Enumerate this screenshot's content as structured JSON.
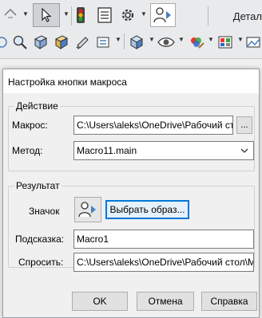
{
  "toolbar": {
    "document_title": "Детал",
    "icons_row1": [
      "dropdown-arrow-icon",
      "select-arrow-icon",
      "traffic-light-icon",
      "properties-icon",
      "gear-icon",
      "macro-user-icon"
    ],
    "icons_row2": [
      "zoom-to-fit-icon",
      "zoom-area-icon",
      "previous-view-icon",
      "section-view-icon",
      "view-orientation-icon",
      "display-style-icon",
      "hide-show-icon",
      "edit-appearance-icon",
      "scenes-icon",
      "view-settings-icon"
    ]
  },
  "dialog": {
    "title": "Настройка кнопки макроса",
    "action_group": {
      "legend": "Действие",
      "macro_label": "Макрос:",
      "macro_value": "C:\\Users\\aleks\\OneDrive\\Рабочий ст",
      "browse_label": "...",
      "method_label": "Метод:",
      "method_value": "Macro11.main"
    },
    "result_group": {
      "legend": "Результат",
      "icon_label": "Значок",
      "choose_image_label": "Выбрать образ...",
      "tooltip_label": "Подсказка:",
      "tooltip_value": "Macro1",
      "prompt_label": "Спросить:",
      "prompt_value": "C:\\Users\\aleks\\OneDrive\\Рабочий стол\\M"
    },
    "buttons": {
      "ok": "OK",
      "cancel": "Отмена",
      "help": "Справка"
    }
  },
  "colors": {
    "focus_border": "#0078d7",
    "dialog_bg": "#f0f0f0",
    "field_border": "#7a7a7a"
  }
}
